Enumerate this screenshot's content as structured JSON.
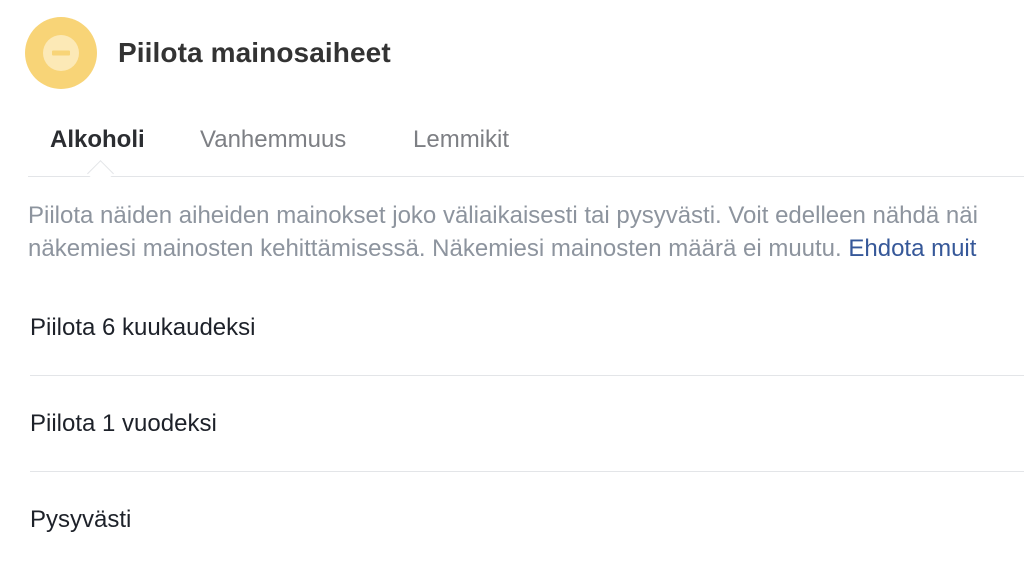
{
  "header": {
    "icon": "hide-circle-icon",
    "title": "Piilota mainosaiheet"
  },
  "tabs": [
    {
      "label": "Alkoholi",
      "active": true
    },
    {
      "label": "Vanhemmuus",
      "active": false
    },
    {
      "label": "Lemmikit",
      "active": false
    }
  ],
  "description": {
    "line1": "Piilota näiden aiheiden mainokset joko väliaikaisesti tai pysyvästi. Voit edelleen nähdä näi",
    "line2_text": "näkemiesi mainosten kehittämisessä. Näkemiesi mainosten määrä ei muutu. ",
    "line2_link": "Ehdota muit"
  },
  "options": [
    {
      "label": "Piilota 6 kuukaudeksi"
    },
    {
      "label": "Piilota 1 vuodeksi"
    },
    {
      "label": "Pysyvästi"
    }
  ],
  "colors": {
    "icon_outer": "#f8d477",
    "icon_inner": "#fce9b6",
    "link": "#365899",
    "muted_text": "#8d949e"
  }
}
